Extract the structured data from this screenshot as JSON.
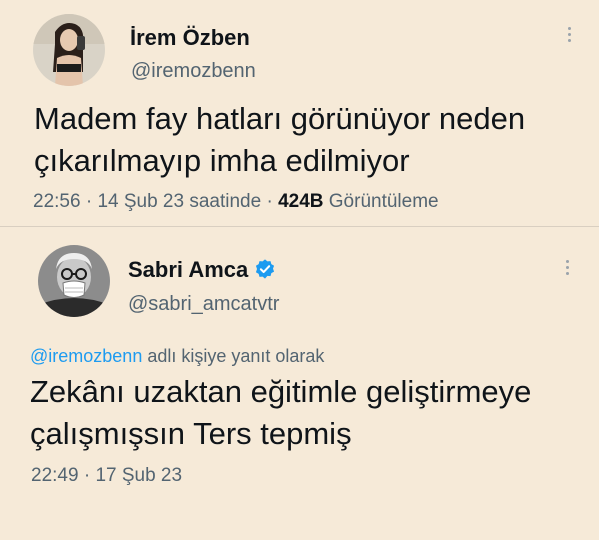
{
  "tweet1": {
    "display_name": "İrem Özben",
    "handle": "@iremozbenn",
    "text_line1": "Madem fay hatları görünüyor neden",
    "text_line2": "çıkarılmayıp imha edilmiyor",
    "time": "22:56",
    "date_text": "14 Şub 23 saatinde",
    "views_count": "424B",
    "views_label": "Görüntüleme",
    "sep": "·"
  },
  "tweet2": {
    "display_name": "Sabri Amca",
    "handle": "@sabri_amcatvtr",
    "reply_mention": "@iremozbenn",
    "reply_suffix": "adlı kişiye yanıt olarak",
    "text_line1": "Zekânı uzaktan eğitimle geliştirmeye",
    "text_line2": "çalışmışsın Ters tepmiş",
    "time": "22:49",
    "date_text": "17 Şub 23",
    "sep": "·"
  },
  "colors": {
    "background": "#f6ead8",
    "text_primary": "#0f1419",
    "text_secondary": "#536471",
    "accent": "#1d9bf0"
  },
  "icons": {
    "more": "more-vertical-icon",
    "verified": "verified-badge-icon"
  }
}
